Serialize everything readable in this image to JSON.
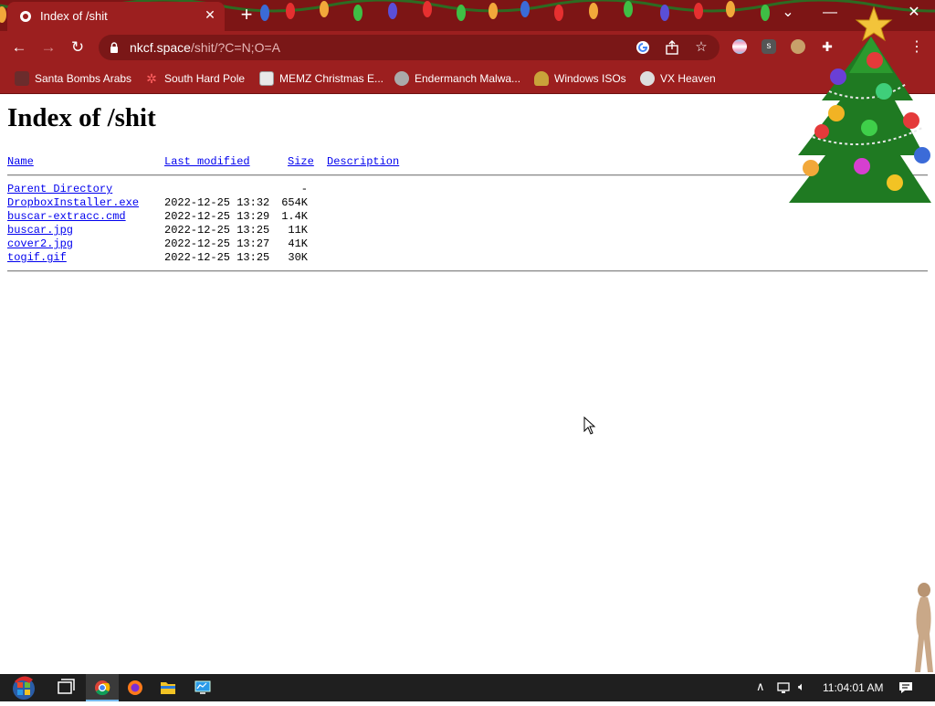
{
  "browser": {
    "tab_title": "Index of /shit",
    "url_host": "nkcf.space",
    "url_path": "/shit/?C=N;O=A"
  },
  "bookmarks": [
    {
      "label": "Santa Bombs Arabs",
      "icon": "santa-icon"
    },
    {
      "label": "South Hard Pole",
      "icon": "snowflake-icon"
    },
    {
      "label": "MEMZ Christmas E...",
      "icon": "memz-icon"
    },
    {
      "label": "Endermanch Malwa...",
      "icon": "raccoon-icon"
    },
    {
      "label": "Windows ISOs",
      "icon": "buddha-icon"
    },
    {
      "label": "VX Heaven",
      "icon": "vx-icon"
    }
  ],
  "page": {
    "heading": "Index of /shit",
    "columns": {
      "name": "Name",
      "modified": "Last modified",
      "size": "Size",
      "description": "Description"
    },
    "parent": {
      "name": "Parent Directory",
      "size": "-"
    },
    "rows": [
      {
        "name": "DropboxInstaller.exe",
        "modified": "2022-12-25 13:32",
        "size": "654K"
      },
      {
        "name": "buscar-extracc.cmd",
        "modified": "2022-12-25 13:29",
        "size": "1.4K"
      },
      {
        "name": "buscar.jpg",
        "modified": "2022-12-25 13:25",
        "size": "11K"
      },
      {
        "name": "cover2.jpg",
        "modified": "2022-12-25 13:27",
        "size": "41K"
      },
      {
        "name": "togif.gif",
        "modified": "2022-12-25 13:25",
        "size": "30K"
      }
    ]
  },
  "taskbar": {
    "clock": "11:04:01 AM",
    "apps": [
      "windows-start-icon",
      "task-view-icon",
      "chrome-icon",
      "firefox-icon",
      "file-explorer-icon",
      "monitor-app-icon"
    ]
  },
  "colors": {
    "chrome_dark": "#7d1515",
    "chrome_main": "#9c1f1f",
    "link": "#0000ee",
    "taskbar": "#1f1f1f"
  }
}
